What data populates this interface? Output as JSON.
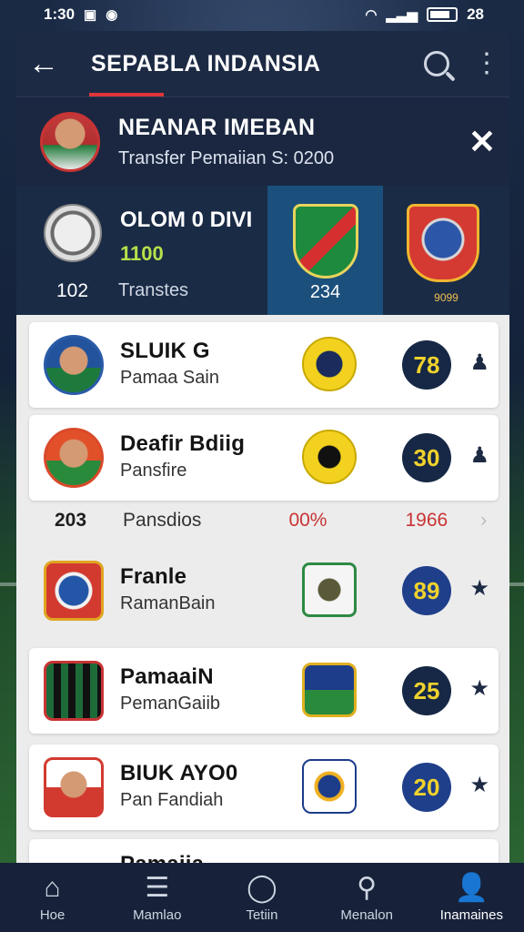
{
  "status": {
    "time": "1:30",
    "battery": "28"
  },
  "header": {
    "title": "SEPABLA INDANSIA"
  },
  "notice": {
    "title": "NEANAR IMEBAN",
    "subtitle": "Transfer Pemaiian S: 0200"
  },
  "score": {
    "name": "OLOM 0 DIVI",
    "value": "1100",
    "count": "102",
    "label": "Transtes",
    "mid_number": "234",
    "right_number": "9099"
  },
  "players": [
    {
      "name": "SLUIK G",
      "sub": "Pamaa Sain",
      "rating": "78"
    },
    {
      "name": "Deafir Bdiig",
      "sub": "Pansfire",
      "rating": "30"
    },
    {
      "name": "Franle",
      "sub": "RamanBain",
      "rating": "89"
    },
    {
      "name": "PamaaiN",
      "sub": "PemanGaiib",
      "rating": "25"
    },
    {
      "name": "BIUK AYO0",
      "sub": "Pan Fandiah",
      "rating": "20"
    },
    {
      "name": "Pamaiia",
      "sub": "",
      "rating": ""
    }
  ],
  "summary_row": {
    "count": "203",
    "label": "Pansdios",
    "percent": "00%",
    "year": "1966"
  },
  "nav": [
    {
      "label": "Hoe",
      "icon": "home-icon"
    },
    {
      "label": "Mamlao",
      "icon": "list-icon"
    },
    {
      "label": "Tetiin",
      "icon": "chat-icon"
    },
    {
      "label": "Menalon",
      "icon": "search-notification-icon"
    },
    {
      "label": "Inamaines",
      "icon": "profile-icon"
    }
  ]
}
